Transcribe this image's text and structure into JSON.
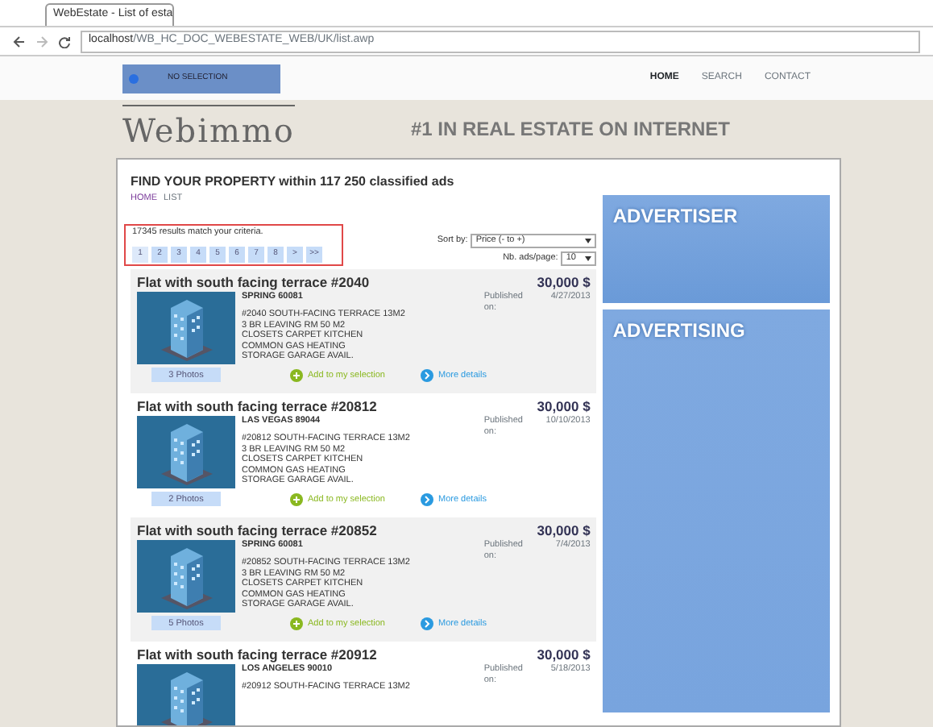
{
  "browser": {
    "tab_title": "WebEstate - List of esta",
    "url_host": "localhost",
    "url_path": "/WB_HC_DOC_WEBESTATE_WEB/UK/list.awp"
  },
  "site_nav": {
    "selection": "NO SELECTION",
    "links": [
      {
        "label": "HOME",
        "selected": true
      },
      {
        "label": "SEARCH",
        "selected": false
      },
      {
        "label": "CONTACT",
        "selected": false
      }
    ]
  },
  "logo": "Webimmo",
  "tagline": "#1 IN REAL ESTATE ON INTERNET",
  "heading": "FIND YOUR PROPERTY within 117 250 classified ads",
  "breadcrumb": [
    {
      "label": "HOME",
      "selected": false
    },
    {
      "label": "LIST",
      "selected": true
    }
  ],
  "results_text": "17345 results match your criteria.",
  "pagination": [
    {
      "label": "1",
      "selected": true
    },
    {
      "label": "2",
      "selected": false
    },
    {
      "label": "3",
      "selected": false
    },
    {
      "label": "4",
      "selected": false
    },
    {
      "label": "5",
      "selected": false
    },
    {
      "label": "6",
      "selected": false
    },
    {
      "label": "7",
      "selected": false
    },
    {
      "label": "8",
      "selected": false
    },
    {
      "label": ">",
      "selected": false
    },
    {
      "label": ">>",
      "selected": false
    }
  ],
  "sort": {
    "label": "Sort by:",
    "value": "Price (- to +)"
  },
  "per_page": {
    "label": "Nb. ads/page:",
    "value": "10"
  },
  "listings": [
    {
      "title": "Flat with south facing terrace #2040",
      "price": "30,000 $",
      "city": "SPRING 60081",
      "published_label": "Published on:",
      "date": "4/27/2013",
      "description": [
        "#2040 SOUTH-FACING TERRACE 13M2",
        "3 BR LEAVING RM 50 M2",
        "CLOSETS CARPET KITCHEN",
        "COMMON GAS HEATING",
        "STORAGE GARAGE AVAIL."
      ],
      "photos": "3 Photos",
      "add": "Add to my selection",
      "details": "More details"
    },
    {
      "title": "Flat with south facing terrace #20812",
      "price": "30,000 $",
      "city": "LAS VEGAS 89044",
      "published_label": "Published on:",
      "date": "10/10/2013",
      "description": [
        "#20812 SOUTH-FACING TERRACE 13M2",
        "3 BR LEAVING RM 50 M2",
        "CLOSETS CARPET KITCHEN",
        "COMMON GAS HEATING",
        "STORAGE GARAGE AVAIL."
      ],
      "photos": "2 Photos",
      "add": "Add to my selection",
      "details": "More details"
    },
    {
      "title": "Flat with south facing terrace #20852",
      "price": "30,000 $",
      "city": "SPRING 60081",
      "published_label": "Published on:",
      "date": "7/4/2013",
      "description": [
        "#20852 SOUTH-FACING TERRACE 13M2",
        "3 BR LEAVING RM 50 M2",
        "CLOSETS CARPET KITCHEN",
        "COMMON GAS HEATING",
        "STORAGE GARAGE AVAIL."
      ],
      "photos": "5 Photos",
      "add": "Add to my selection",
      "details": "More details"
    },
    {
      "title": "Flat with south facing terrace #20912",
      "price": "30,000 $",
      "city": "LOS ANGELES 90010",
      "published_label": "Published on:",
      "date": "5/18/2013",
      "description": [
        "#20912 SOUTH-FACING TERRACE 13M2"
      ]
    }
  ],
  "side_panels": [
    "ADVERTISER",
    "ADVERTISING"
  ]
}
